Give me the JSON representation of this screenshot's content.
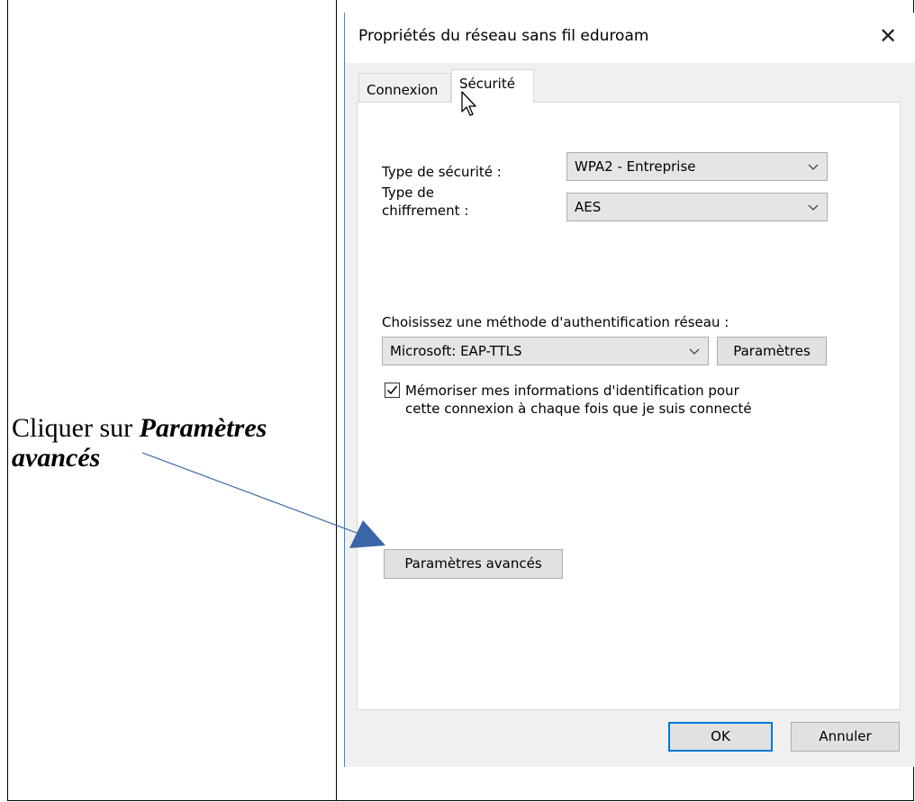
{
  "instruction": {
    "prefix": "Cliquer sur ",
    "bold_part1": "Paramètres",
    "bold_part2": "avancés"
  },
  "dialog": {
    "title": "Propriétés du réseau sans fil eduroam",
    "close_glyph": "✕",
    "tabs": [
      {
        "label": "Connexion",
        "active": false
      },
      {
        "label": "Sécurité",
        "active": true
      }
    ],
    "security_type": {
      "label": "Type de sécurité :",
      "value": "WPA2 - Entreprise"
    },
    "encryption_type": {
      "label_line1": "Type de",
      "label_line2": "chiffrement :",
      "value": "AES"
    },
    "auth_method": {
      "label": "Choisissez une méthode d'authentification réseau :",
      "value": "Microsoft: EAP-TTLS",
      "settings_button": "Paramètres"
    },
    "remember": {
      "checked": true,
      "line1": "Mémoriser mes informations d'identification pour",
      "line2": "cette connexion à chaque fois que je suis connecté"
    },
    "advanced_button": "Paramètres avancés",
    "ok_button": "OK",
    "cancel_button": "Annuler"
  },
  "colors": {
    "accent": "#0078d7",
    "arrow": "#3a66a8",
    "dialog_bg": "#f0f0f0"
  },
  "icons": [
    "close-icon",
    "chevron-down-icon",
    "checkmark-icon",
    "mouse-pointer-icon",
    "callout-arrow-icon"
  ]
}
